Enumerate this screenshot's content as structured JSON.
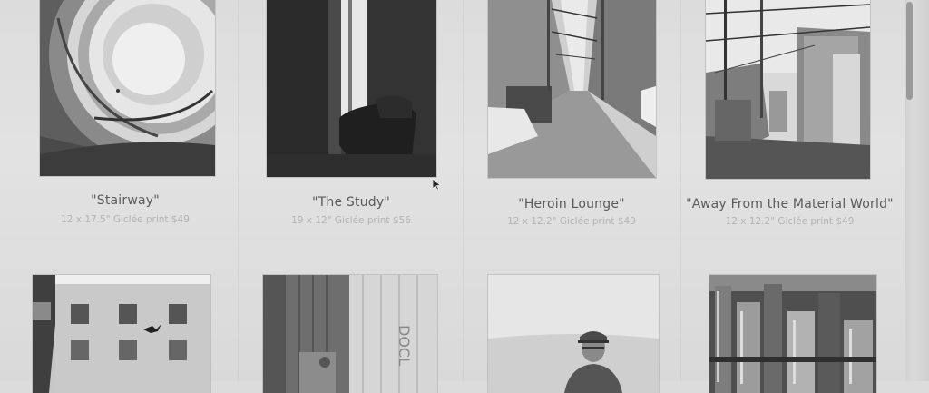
{
  "gallery": {
    "items": [
      {
        "title": "\"Stairway\"",
        "meta": "12 x 17.5\" Giclée print $49",
        "image_icon": "spiral-stairway-photo"
      },
      {
        "title": "\"The Study\"",
        "meta": "19 x 12\" Giclée print $56",
        "image_icon": "study-room-chair-photo"
      },
      {
        "title": "\"Heroin Lounge\"",
        "meta": "12 x 12.2\" Giclée print $49",
        "image_icon": "alley-photo"
      },
      {
        "title": "\"Away From the Material World\"",
        "meta": "12 x 12.2\" Giclée print $49",
        "image_icon": "power-lines-alley-photo"
      },
      {
        "title": "",
        "meta": "",
        "image_icon": "building-with-bird-photo"
      },
      {
        "title": "",
        "meta": "",
        "image_icon": "wooden-door-crate-photo"
      },
      {
        "title": "",
        "meta": "",
        "image_icon": "man-in-cap-photo"
      },
      {
        "title": "",
        "meta": "",
        "image_icon": "city-aerial-photo"
      }
    ],
    "photo_lettering": "DOCL"
  },
  "colors": {
    "background": "#dedede",
    "title": "#5a5a5a",
    "meta": "#b3b3b3",
    "scrollbar_thumb": "#9a9a9a"
  }
}
